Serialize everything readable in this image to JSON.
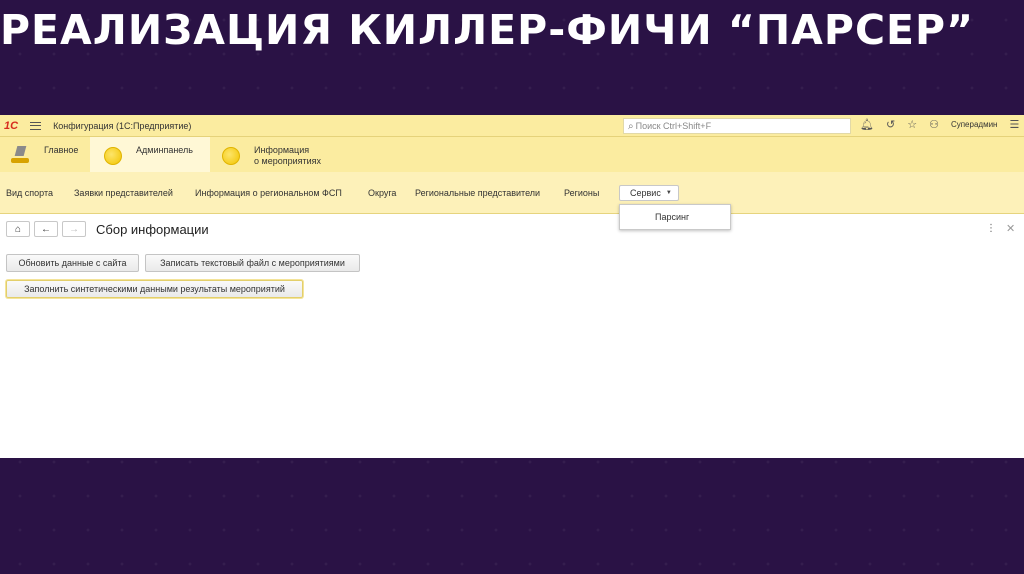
{
  "slide": {
    "title": "РЕАЛИЗАЦИЯ КИЛЛЕР-ФИЧИ “ПАРСЕР”"
  },
  "topbar": {
    "logo": "1С",
    "app_title": "Конфигурация  (1С:Предприятие)",
    "search_placeholder": "Поиск Ctrl+Shift+F",
    "user": "Суперадмин"
  },
  "sections": [
    {
      "label": "Главное"
    },
    {
      "label": "Админпанель"
    },
    {
      "label_line1": "Информация",
      "label_line2": "о мероприятиях"
    }
  ],
  "nav": {
    "items": [
      "Вид спорта",
      "Заявки представителей",
      "Информация о региональном ФСП",
      "Округа",
      "Региональные представители",
      "Регионы"
    ],
    "service_label": "Сервис",
    "dropdown_item": "Парсинг"
  },
  "form": {
    "title": "Сбор информации",
    "buttons": {
      "update": "Обновить данные с сайта",
      "write_file": "Записать текстовый файл с мероприятиями",
      "fill_synthetic": "Заполнить синтетическими данными результаты мероприятий"
    }
  },
  "colors": {
    "slide_bg": "#2a1245",
    "panel_yellow": "#fbeca0",
    "nav_yellow": "#fdf1b9",
    "logo_red": "#d62c1f"
  }
}
